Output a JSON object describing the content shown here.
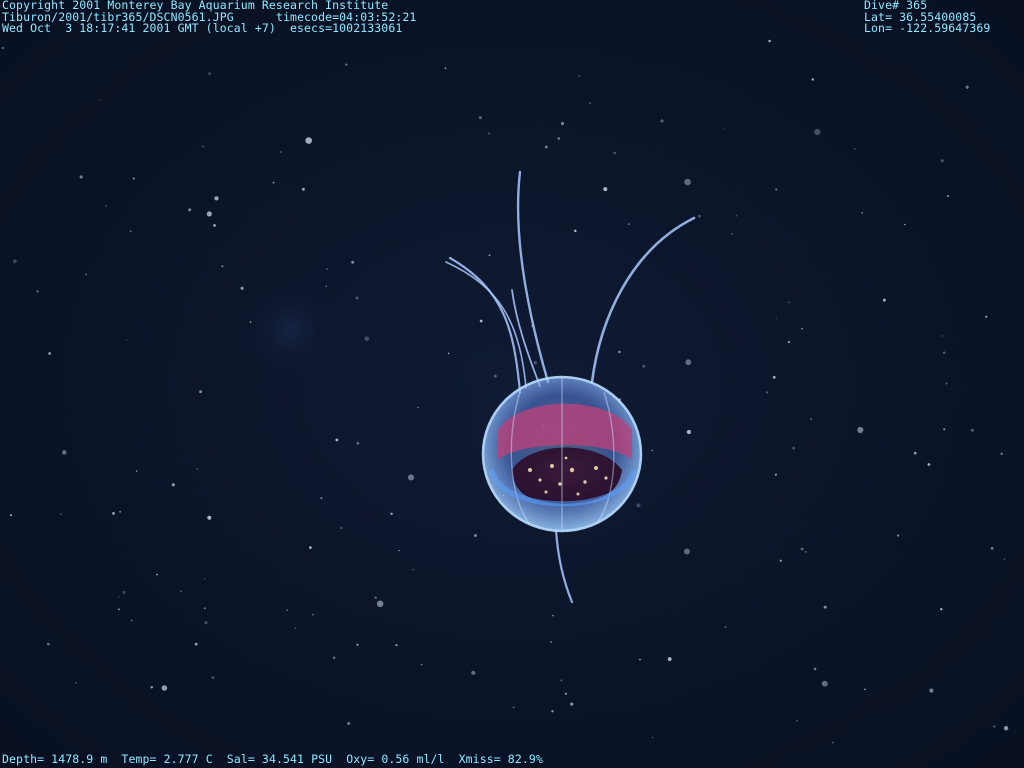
{
  "overlay": {
    "top_left": {
      "line1_copyright": "Copyright 2001 Monterey Bay Aquarium Research Institute",
      "line2_file": "Tiburon/2001/tibr365/DSCN0561.JPG",
      "line2_timecode": "timecode=04:03:52:21",
      "line3_datetime": "Wed Oct  3 18:17:41 2001 GMT (local +7)",
      "line3_esecs": "esecs=1002133061"
    },
    "top_right": {
      "dive": "Dive# 365",
      "lat": "Lat= 36.55400085",
      "lon": "Lon= -122.59647369"
    },
    "bottom": {
      "depth": "Depth= 1478.9 m",
      "temp": "Temp= 2.777 C",
      "sal": "Sal= 34.541 PSU",
      "oxy": "Oxy= 0.56 ml/l",
      "xmiss": "Xmiss= 82.9%"
    }
  },
  "colors": {
    "overlay_text": "#8fe9ff",
    "background": "#0b1324",
    "bell": "#6fa0ff",
    "stomach": "#c0407a"
  },
  "scene": {
    "subject_icon": "jellyfish-icon"
  }
}
